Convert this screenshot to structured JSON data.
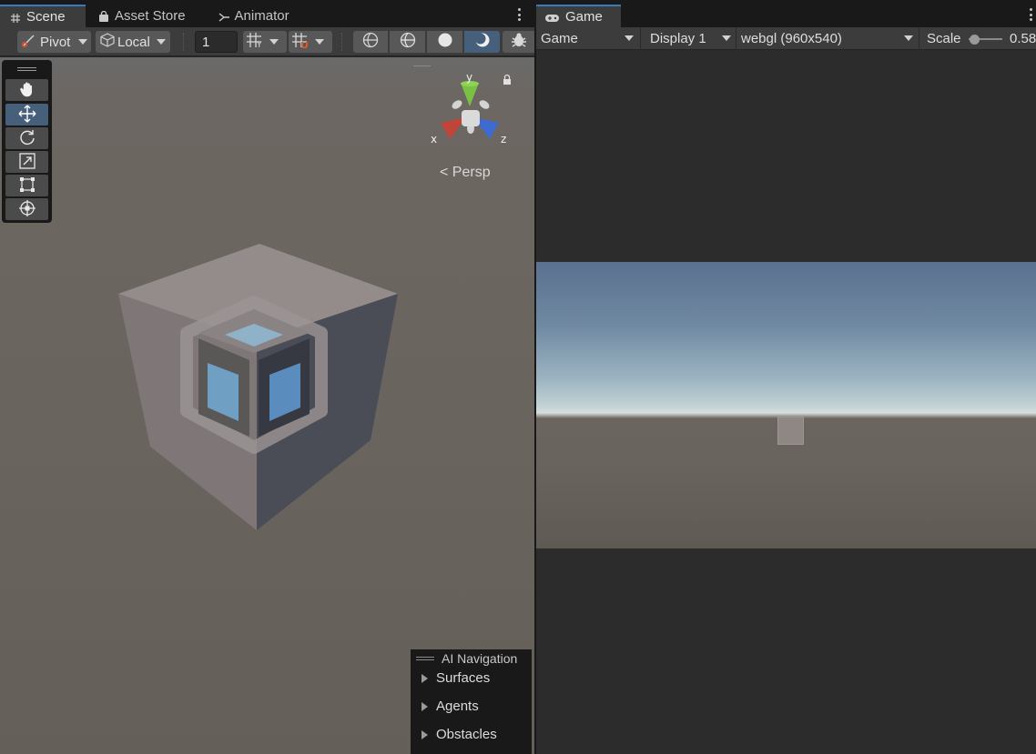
{
  "scene_window": {
    "tabs": [
      {
        "label": "Scene",
        "icon": "grid-icon",
        "active": true
      },
      {
        "label": "Asset Store",
        "icon": "shopping-bag-icon",
        "active": false
      },
      {
        "label": "Animator",
        "icon": "animator-icon",
        "active": false
      }
    ],
    "toolbar": {
      "pivot_label": "Pivot",
      "space_label": "Local",
      "grid_snap_value": "1"
    },
    "tools": [
      "hand-tool",
      "move-tool",
      "rotate-tool",
      "scale-tool",
      "rect-tool",
      "transform-tool"
    ],
    "selected_tool": "move-tool",
    "gizmo": {
      "y": "y",
      "x": "x",
      "z": "z"
    },
    "projection_label": "Persp",
    "ai_navigation": {
      "title": "AI Navigation",
      "items": [
        "Surfaces",
        "Agents",
        "Obstacles"
      ]
    }
  },
  "game_window": {
    "tab_label": "Game",
    "tab_icon": "gamepad-icon",
    "mode_label": "Game",
    "display_label": "Display 1",
    "resolution_label": "webgl (960x540)",
    "scale_label": "Scale",
    "scale_value": "0.58",
    "scale_slider_fraction": 0.05
  },
  "colors": {
    "accent": "#3a79bb",
    "selected_tool": "#46607c",
    "panel_bg": "#3c3c3c",
    "window_bg": "#191919"
  }
}
